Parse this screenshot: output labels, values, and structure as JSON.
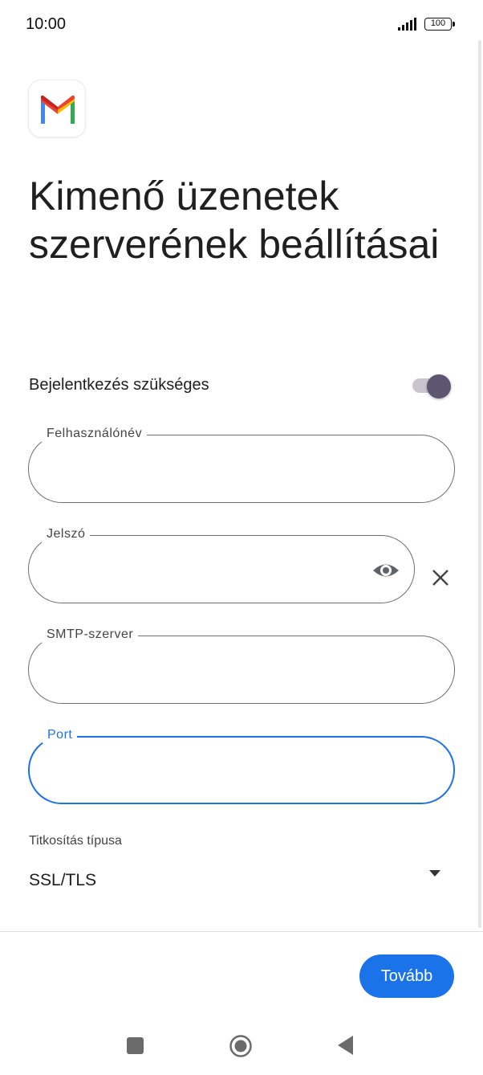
{
  "status_bar": {
    "time": "10:00",
    "battery": "100"
  },
  "app": {
    "logo_icon": "gmail-logo-icon",
    "colors": {
      "red": "#EA4335",
      "blue": "#4285F4",
      "green": "#34A853",
      "yellow": "#FBBC04",
      "dark_red": "#C5221F"
    }
  },
  "page": {
    "title": "Kimenő üzenetek szerverének beállításai"
  },
  "login_toggle": {
    "label": "Bejelentkezés szükséges",
    "state": "on"
  },
  "fields": {
    "username": {
      "label": "Felhasználónév",
      "value": ""
    },
    "password": {
      "label": "Jelszó",
      "value": ""
    },
    "smtp": {
      "label": "SMTP-szerver",
      "value": ""
    },
    "port": {
      "label": "Port",
      "value": "",
      "focused": true
    }
  },
  "encryption": {
    "label": "Titkosítás típusa",
    "selected": "SSL/TLS"
  },
  "buttons": {
    "next": "Tovább"
  },
  "theme": {
    "accent": "#1a73e8",
    "toggle_knob": "#5d5670",
    "toggle_track": "#c9c4d0"
  },
  "nav_bar": {
    "icons": [
      "recent-apps-icon",
      "home-icon",
      "back-icon"
    ]
  }
}
